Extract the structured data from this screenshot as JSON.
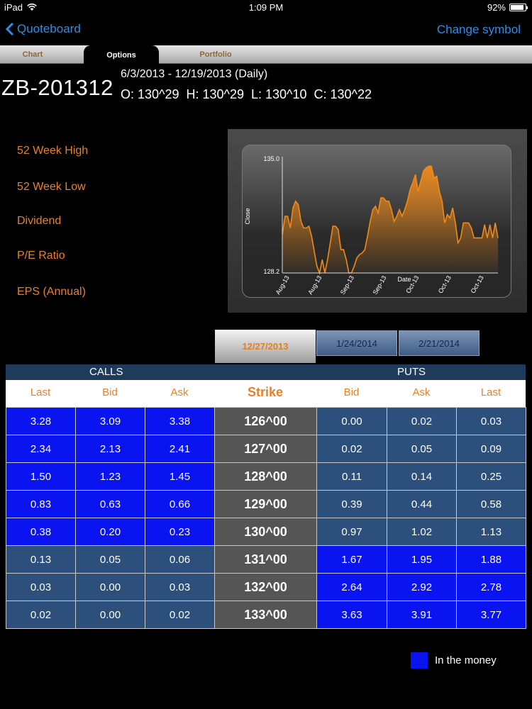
{
  "status": {
    "device": "iPad",
    "time": "1:09 PM",
    "battery": "92%",
    "battery_level": 0.92
  },
  "nav": {
    "back_label": "Quoteboard",
    "right_label": "Change symbol"
  },
  "tabs": [
    "Chart",
    "Options",
    "Portfolio"
  ],
  "active_tab": "Options",
  "header": {
    "symbol": "ZB-201312",
    "range": "6/3/2013 - 12/19/2013 (Daily)",
    "ohlc": "O: 130^29  H: 130^29  L: 130^10  C: 130^22"
  },
  "stats": [
    "52 Week High",
    "52 Week Low",
    "Dividend",
    "P/E Ratio",
    "EPS (Annual)"
  ],
  "chart_data": {
    "type": "area",
    "ylabel": "Close",
    "xlabel": "Date",
    "ylim": [
      128.2,
      135.0
    ],
    "ytick_labels": [
      "135.0",
      "128.2"
    ],
    "xtick_labels": [
      "Aug-13",
      "Aug-13",
      "Sep-13",
      "Sep-13",
      "Oct-13",
      "Oct-13",
      "Oct-13"
    ],
    "color": "#f08a18",
    "values": [
      130.5,
      131.6,
      131.6,
      130.9,
      132.1,
      132.5,
      132.3,
      131.3,
      130.9,
      130.9,
      131.0,
      130.4,
      129.5,
      128.6,
      128.2,
      129.0,
      128.2,
      129.0,
      130.0,
      131.0,
      131.0,
      130.8,
      129.6,
      129.6,
      129.0,
      128.2,
      128.2,
      128.6,
      129.1,
      129.3,
      129.4,
      129.6,
      130.4,
      131.3,
      132.0,
      132.2,
      131.8,
      132.7,
      132.7,
      132.5,
      132.5,
      132.0,
      131.3,
      131.6,
      132.0,
      131.6,
      132.0,
      132.5,
      133.2,
      133.6,
      134.1,
      133.1,
      133.7,
      134.3,
      134.5,
      134.6,
      134.6,
      133.9,
      134.0,
      133.1,
      132.5,
      131.2,
      131.7,
      131.5,
      132.1,
      131.2,
      130.0,
      130.3,
      131.2,
      131.2,
      131.2,
      130.9,
      130.3,
      130.3,
      130.3,
      130.3,
      131.1,
      130.3,
      131.1,
      130.3,
      131.2,
      130.3
    ]
  },
  "expirations": [
    "12/27/2013",
    "1/24/2014",
    "2/21/2014"
  ],
  "active_expiration": "12/27/2013",
  "table": {
    "calls_label": "CALLS",
    "puts_label": "PUTS",
    "columns": [
      "Last",
      "Bid",
      "Ask",
      "Strike",
      "Bid",
      "Ask",
      "Last"
    ],
    "rows": [
      {
        "call_last": "3.28",
        "call_bid": "3.09",
        "call_ask": "3.38",
        "strike": "126^00",
        "put_bid": "0.00",
        "put_ask": "0.02",
        "put_last": "0.03",
        "call_itm": true,
        "put_itm": false
      },
      {
        "call_last": "2.34",
        "call_bid": "2.13",
        "call_ask": "2.41",
        "strike": "127^00",
        "put_bid": "0.02",
        "put_ask": "0.05",
        "put_last": "0.09",
        "call_itm": true,
        "put_itm": false
      },
      {
        "call_last": "1.50",
        "call_bid": "1.23",
        "call_ask": "1.45",
        "strike": "128^00",
        "put_bid": "0.11",
        "put_ask": "0.14",
        "put_last": "0.25",
        "call_itm": true,
        "put_itm": false
      },
      {
        "call_last": "0.83",
        "call_bid": "0.63",
        "call_ask": "0.66",
        "strike": "129^00",
        "put_bid": "0.39",
        "put_ask": "0.44",
        "put_last": "0.58",
        "call_itm": true,
        "put_itm": false
      },
      {
        "call_last": "0.38",
        "call_bid": "0.20",
        "call_ask": "0.23",
        "strike": "130^00",
        "put_bid": "0.97",
        "put_ask": "1.02",
        "put_last": "1.13",
        "call_itm": true,
        "put_itm": false
      },
      {
        "call_last": "0.13",
        "call_bid": "0.05",
        "call_ask": "0.06",
        "strike": "131^00",
        "put_bid": "1.67",
        "put_ask": "1.95",
        "put_last": "1.88",
        "call_itm": false,
        "put_itm": true
      },
      {
        "call_last": "0.03",
        "call_bid": "0.00",
        "call_ask": "0.03",
        "strike": "132^00",
        "put_bid": "2.64",
        "put_ask": "2.92",
        "put_last": "2.78",
        "call_itm": false,
        "put_itm": true
      },
      {
        "call_last": "0.02",
        "call_bid": "0.00",
        "call_ask": "0.02",
        "strike": "133^00",
        "put_bid": "3.63",
        "put_ask": "3.91",
        "put_last": "3.77",
        "call_itm": false,
        "put_itm": true
      }
    ]
  },
  "legend": {
    "label": "In the money",
    "color": "#0a14f0"
  },
  "colors": {
    "accent": "#e8802a",
    "link": "#2f8ee8",
    "itm": "#0a14f0",
    "otm": "#2d4f7c"
  }
}
